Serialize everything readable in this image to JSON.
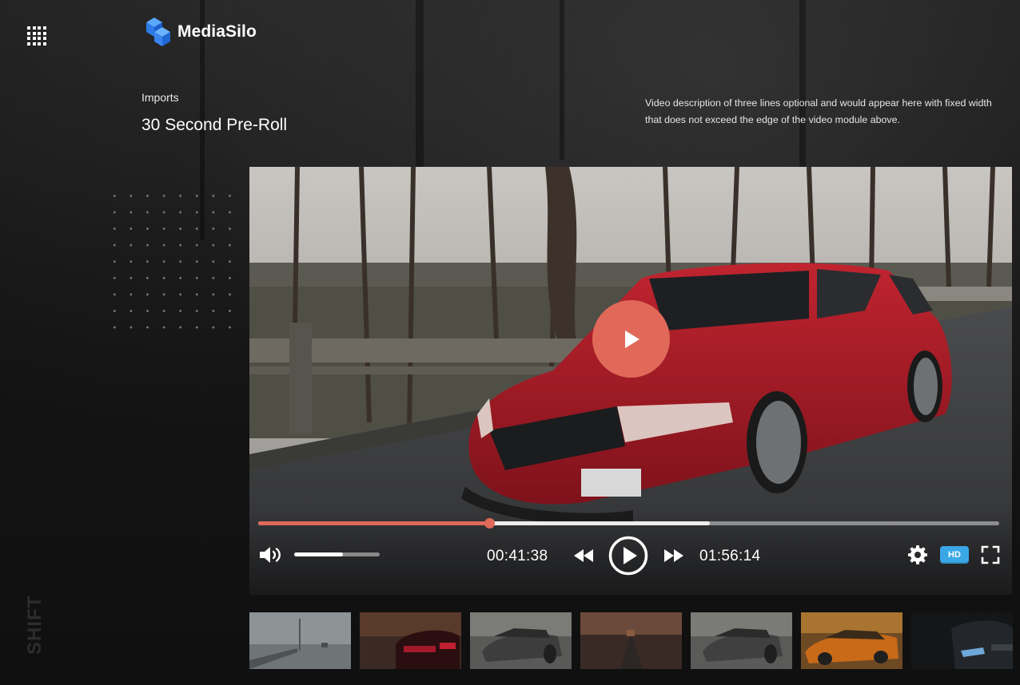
{
  "app": {
    "name": "MediaSilo"
  },
  "header": {
    "breadcrumb": "Imports",
    "title": "30 Second Pre-Roll",
    "description": "Video description of three lines optional and would appear here with fixed width that does not exceed the edge of the video module above."
  },
  "sidebar": {
    "watermark": "SHIFT"
  },
  "player": {
    "current_time": "00:41:38",
    "total_time": "01:56:14",
    "progress": 0.312,
    "buffered": 0.61,
    "volume": 0.57,
    "quality_label": "HD",
    "accent_color": "#e0695a",
    "hd_color": "#3aa7e6"
  },
  "icons": {
    "apps": "apps-grid-icon",
    "logo": "mediasilo-logo-icon",
    "play_large": "play-circle-icon",
    "volume": "volume-icon",
    "rewind": "rewind-icon",
    "play": "play-icon",
    "fast_forward": "fast-forward-icon",
    "settings": "gear-icon",
    "fullscreen": "fullscreen-icon"
  },
  "thumbnails": [
    {
      "scene": "foggy-pier"
    },
    {
      "scene": "red-car-taillights"
    },
    {
      "scene": "car-front-grey"
    },
    {
      "scene": "road-sunset"
    },
    {
      "scene": "car-front-grey"
    },
    {
      "scene": "orange-car"
    },
    {
      "scene": "dark-car-headlight"
    }
  ]
}
